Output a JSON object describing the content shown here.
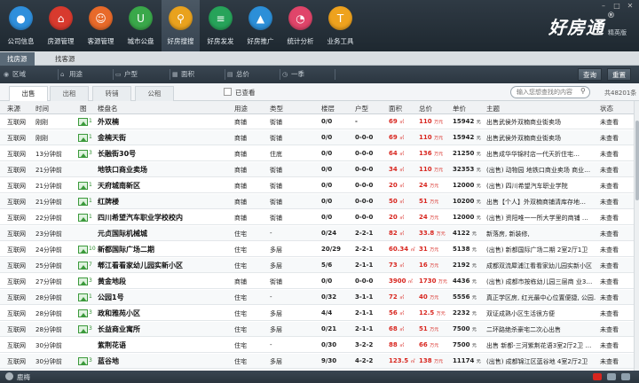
{
  "logo": {
    "name": "好房通",
    "sup": "®",
    "edition": "精英版"
  },
  "nav": [
    {
      "label": "公司信息",
      "color": "#2f8fdc",
      "icon": "chat-icon",
      "glyph": "●"
    },
    {
      "label": "房源管理",
      "color": "#d83a2e",
      "icon": "house-icon",
      "glyph": "⌂"
    },
    {
      "label": "客源管理",
      "color": "#e86a2a",
      "icon": "user-icon",
      "glyph": "☺"
    },
    {
      "label": "城市公盘",
      "color": "#3aa84a",
      "icon": "bag-icon",
      "glyph": "U"
    },
    {
      "label": "好房搜搜",
      "color": "#e9a21e",
      "icon": "search-icon",
      "glyph": "⚲"
    },
    {
      "label": "好房发发",
      "color": "#27a35a",
      "icon": "stack-icon",
      "glyph": "≡"
    },
    {
      "label": "好房推广",
      "color": "#2c8fd8",
      "icon": "rocket-icon",
      "glyph": "▲"
    },
    {
      "label": "统计分析",
      "color": "#e0456a",
      "icon": "pie-icon",
      "glyph": "◔"
    },
    {
      "label": "业务工具",
      "color": "#eea21e",
      "icon": "tool-icon",
      "glyph": "T"
    }
  ],
  "subnav": [
    "找房源",
    "找客源"
  ],
  "filters": {
    "area": "区域",
    "usage": "用途",
    "layout": "户型",
    "size": "面积",
    "price": "总价",
    "period": "一季",
    "search_btn": "查询",
    "reset_btn": "重置"
  },
  "tabs": [
    "出售",
    "出租",
    "转铺",
    "公租"
  ],
  "viewed_label": "已查看",
  "search_placeholder": "输入您想查找的内容",
  "total": "共48201条",
  "columns": [
    "来源",
    "时间",
    "图",
    "楼盘名",
    "用途",
    "类型",
    "楼层",
    "户型",
    "面积",
    "总价",
    "单价",
    "主题",
    "状态"
  ],
  "units": {
    "area": "㎡",
    "price": "万元",
    "unit_price": "元"
  },
  "rows": [
    {
      "src": "互联网",
      "time": "刚刚",
      "pic": "1",
      "name": "外双楠",
      "use": "商铺",
      "type": "街铺",
      "floor": "0/0",
      "layout": "-",
      "area": "69",
      "price": "110",
      "unit": "15942",
      "title": "出售武侯外双楠商业街卖场",
      "status": "未查看"
    },
    {
      "src": "互联网",
      "time": "刚刚",
      "pic": "1",
      "name": "金楠天街",
      "use": "商铺",
      "type": "街铺",
      "floor": "0/0",
      "layout": "0-0-0",
      "area": "69",
      "price": "110",
      "unit": "15942",
      "title": "出售武侯外双楠商业街卖场",
      "status": "未查看"
    },
    {
      "src": "互联网",
      "time": "13分钟前",
      "pic": "3",
      "name": "长融街30号",
      "use": "商铺",
      "type": "住底",
      "floor": "0/0",
      "layout": "0-0-0",
      "area": "64",
      "price": "136",
      "unit": "21250",
      "title": "出售成华华锦村店一代天折住宅…",
      "status": "未查看"
    },
    {
      "src": "互联网",
      "time": "21分钟前",
      "pic": "",
      "name": "地铁口商业卖场",
      "use": "商铺",
      "type": "街铺",
      "floor": "0/0",
      "layout": "0-0-0",
      "area": "34",
      "price": "110",
      "unit": "32353",
      "title": "(出售) 动物园 地铁口商业卖场 商业…",
      "status": "未查看"
    },
    {
      "src": "互联网",
      "time": "21分钟前",
      "pic": "1",
      "name": "天府城南新区",
      "use": "商铺",
      "type": "街铺",
      "floor": "0/0",
      "layout": "0-0-0",
      "area": "20",
      "price": "24",
      "unit": "12000",
      "title": "(出售) 四川希望汽车职业学院",
      "status": "未查看"
    },
    {
      "src": "互联网",
      "time": "21分钟前",
      "pic": "1",
      "name": "红牌楼",
      "use": "商铺",
      "type": "街铺",
      "floor": "0/0",
      "layout": "0-0-0",
      "area": "50",
      "price": "51",
      "unit": "10200",
      "title": "出售【个人】外双楠商铺清库存地…",
      "status": "未查看"
    },
    {
      "src": "互联网",
      "time": "22分钟前",
      "pic": "1",
      "name": "四川希望汽车职业学校校内",
      "use": "商铺",
      "type": "街铺",
      "floor": "0/0",
      "layout": "0-0-0",
      "area": "20",
      "price": "24",
      "unit": "12000",
      "title": "(出售) 资阳唯一一所大学里的商铺 …",
      "status": "未查看"
    },
    {
      "src": "互联网",
      "time": "23分钟前",
      "pic": "",
      "name": "元贞国际机械城",
      "use": "住宅",
      "type": "-",
      "floor": "0/24",
      "layout": "2-2-1",
      "area": "82",
      "price": "33.8",
      "unit": "4122",
      "title": "新落房, 新装修,",
      "status": "未查看"
    },
    {
      "src": "互联网",
      "time": "24分钟前",
      "pic": "10",
      "name": "新都国际广场二期",
      "use": "住宅",
      "type": "多层",
      "floor": "20/29",
      "layout": "2-2-1",
      "area": "60.34",
      "price": "31",
      "unit": "5138",
      "title": "(出售) 新都国际广场二期 2室2厅1卫",
      "status": "未查看"
    },
    {
      "src": "互联网",
      "time": "25分钟前",
      "pic": "7",
      "name": "郫江看看家幼儿园实新小区",
      "use": "住宅",
      "type": "多层",
      "floor": "5/6",
      "layout": "2-1-1",
      "area": "73",
      "price": "16",
      "unit": "2192",
      "title": "成都双流犀浦江看看家幼儿园实新小区",
      "status": "未查看"
    },
    {
      "src": "互联网",
      "time": "27分钟前",
      "pic": "3",
      "name": "黄金地段",
      "use": "商铺",
      "type": "街铺",
      "floor": "0/0",
      "layout": "0-0-0",
      "area": "3900",
      "price": "1730",
      "unit": "4436",
      "title": "(出售) 成都市按栋幼儿园三层商 业3…",
      "status": "未查看"
    },
    {
      "src": "互联网",
      "time": "28分钟前",
      "pic": "1",
      "name": "公园1号",
      "use": "住宅",
      "type": "-",
      "floor": "0/32",
      "layout": "3-1-1",
      "area": "72",
      "price": "40",
      "unit": "5556",
      "title": "真正学区房, 红光最中心位置便捷, 公园…",
      "status": "未查看"
    },
    {
      "src": "互联网",
      "time": "28分钟前",
      "pic": "3",
      "name": "政和雅苑小区",
      "use": "住宅",
      "type": "多层",
      "floor": "4/4",
      "layout": "2-1-1",
      "area": "56",
      "price": "12.5",
      "unit": "2232",
      "title": "双证成熟小区生活很方便",
      "status": "未查看"
    },
    {
      "src": "互联网",
      "time": "28分钟前",
      "pic": "3",
      "name": "长益商业寓所",
      "use": "住宅",
      "type": "多层",
      "floor": "0/21",
      "layout": "2-1-1",
      "area": "68",
      "price": "51",
      "unit": "7500",
      "title": "二环路绝杀豪宅二次心出售",
      "status": "未查看"
    },
    {
      "src": "互联网",
      "time": "30分钟前",
      "pic": "",
      "name": "紫荆花语",
      "use": "住宅",
      "type": "-",
      "floor": "0/30",
      "layout": "3-2-2",
      "area": "88",
      "price": "66",
      "unit": "7500",
      "title": "出售 新都-三河紫荆花语3室2厅2卫 …",
      "status": "未查看"
    },
    {
      "src": "互联网",
      "time": "30分钟前",
      "pic": "3",
      "name": "蓝谷地",
      "use": "住宅",
      "type": "多层",
      "floor": "9/30",
      "layout": "4-2-2",
      "area": "123.5",
      "price": "138",
      "unit": "11174",
      "title": "(出售) 成都锦江区蓝谷地 4室2厅2卫",
      "status": "未查看"
    }
  ],
  "status_bar": {
    "user": "鹿梅"
  },
  "colors": {
    "accent": "#2f8fdc",
    "red": "#d8261f",
    "topbar": "#27323b"
  }
}
